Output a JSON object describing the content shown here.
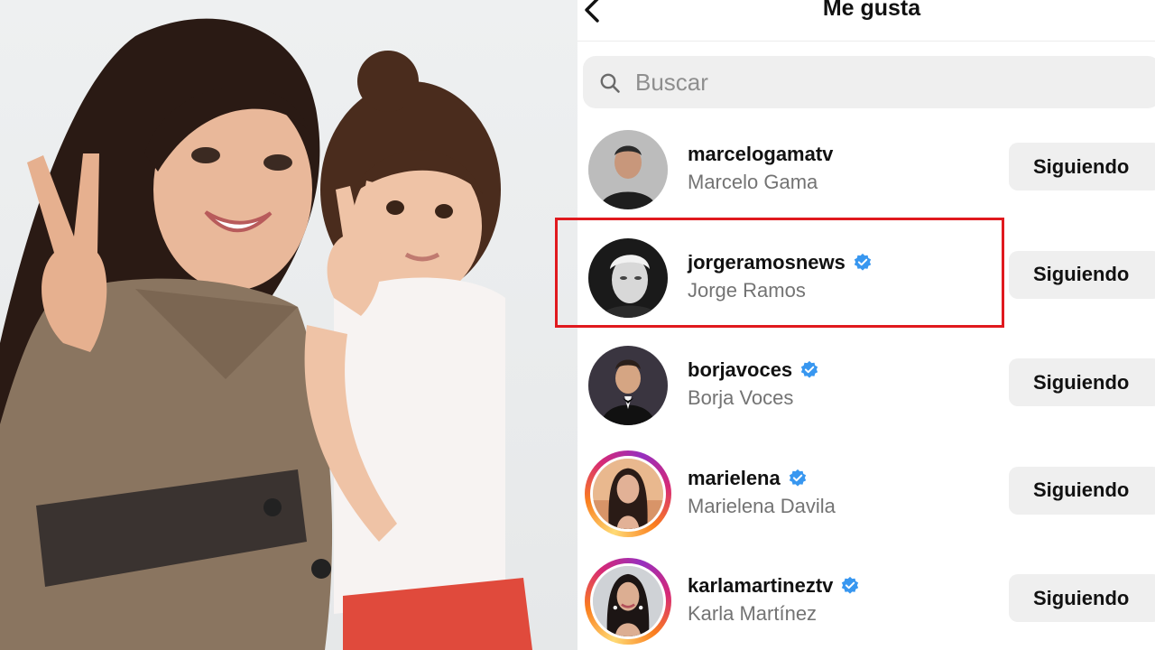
{
  "header": {
    "title": "Me gusta",
    "back_icon": "chevron-left-icon"
  },
  "search": {
    "placeholder": "Buscar",
    "value": "",
    "icon": "search-icon"
  },
  "users": [
    {
      "username": "marcelogamatv",
      "full_name": "Marcelo Gama",
      "verified": false,
      "story_ring": false,
      "button": "Siguiendo"
    },
    {
      "username": "jorgeramosnews",
      "full_name": "Jorge Ramos",
      "verified": true,
      "story_ring": false,
      "button": "Siguiendo",
      "highlighted": true
    },
    {
      "username": "borjavoces",
      "full_name": "Borja Voces",
      "verified": true,
      "story_ring": false,
      "button": "Siguiendo"
    },
    {
      "username": "marielena",
      "full_name": "Marielena Davila",
      "verified": true,
      "story_ring": true,
      "button": "Siguiendo"
    },
    {
      "username": "karlamartineztv",
      "full_name": "Karla Martínez",
      "verified": true,
      "story_ring": true,
      "button": "Siguiendo"
    }
  ],
  "colors": {
    "highlight": "#e0191e",
    "verified": "#3897f0",
    "button_bg": "#efefef",
    "secondary_text": "#737373"
  }
}
